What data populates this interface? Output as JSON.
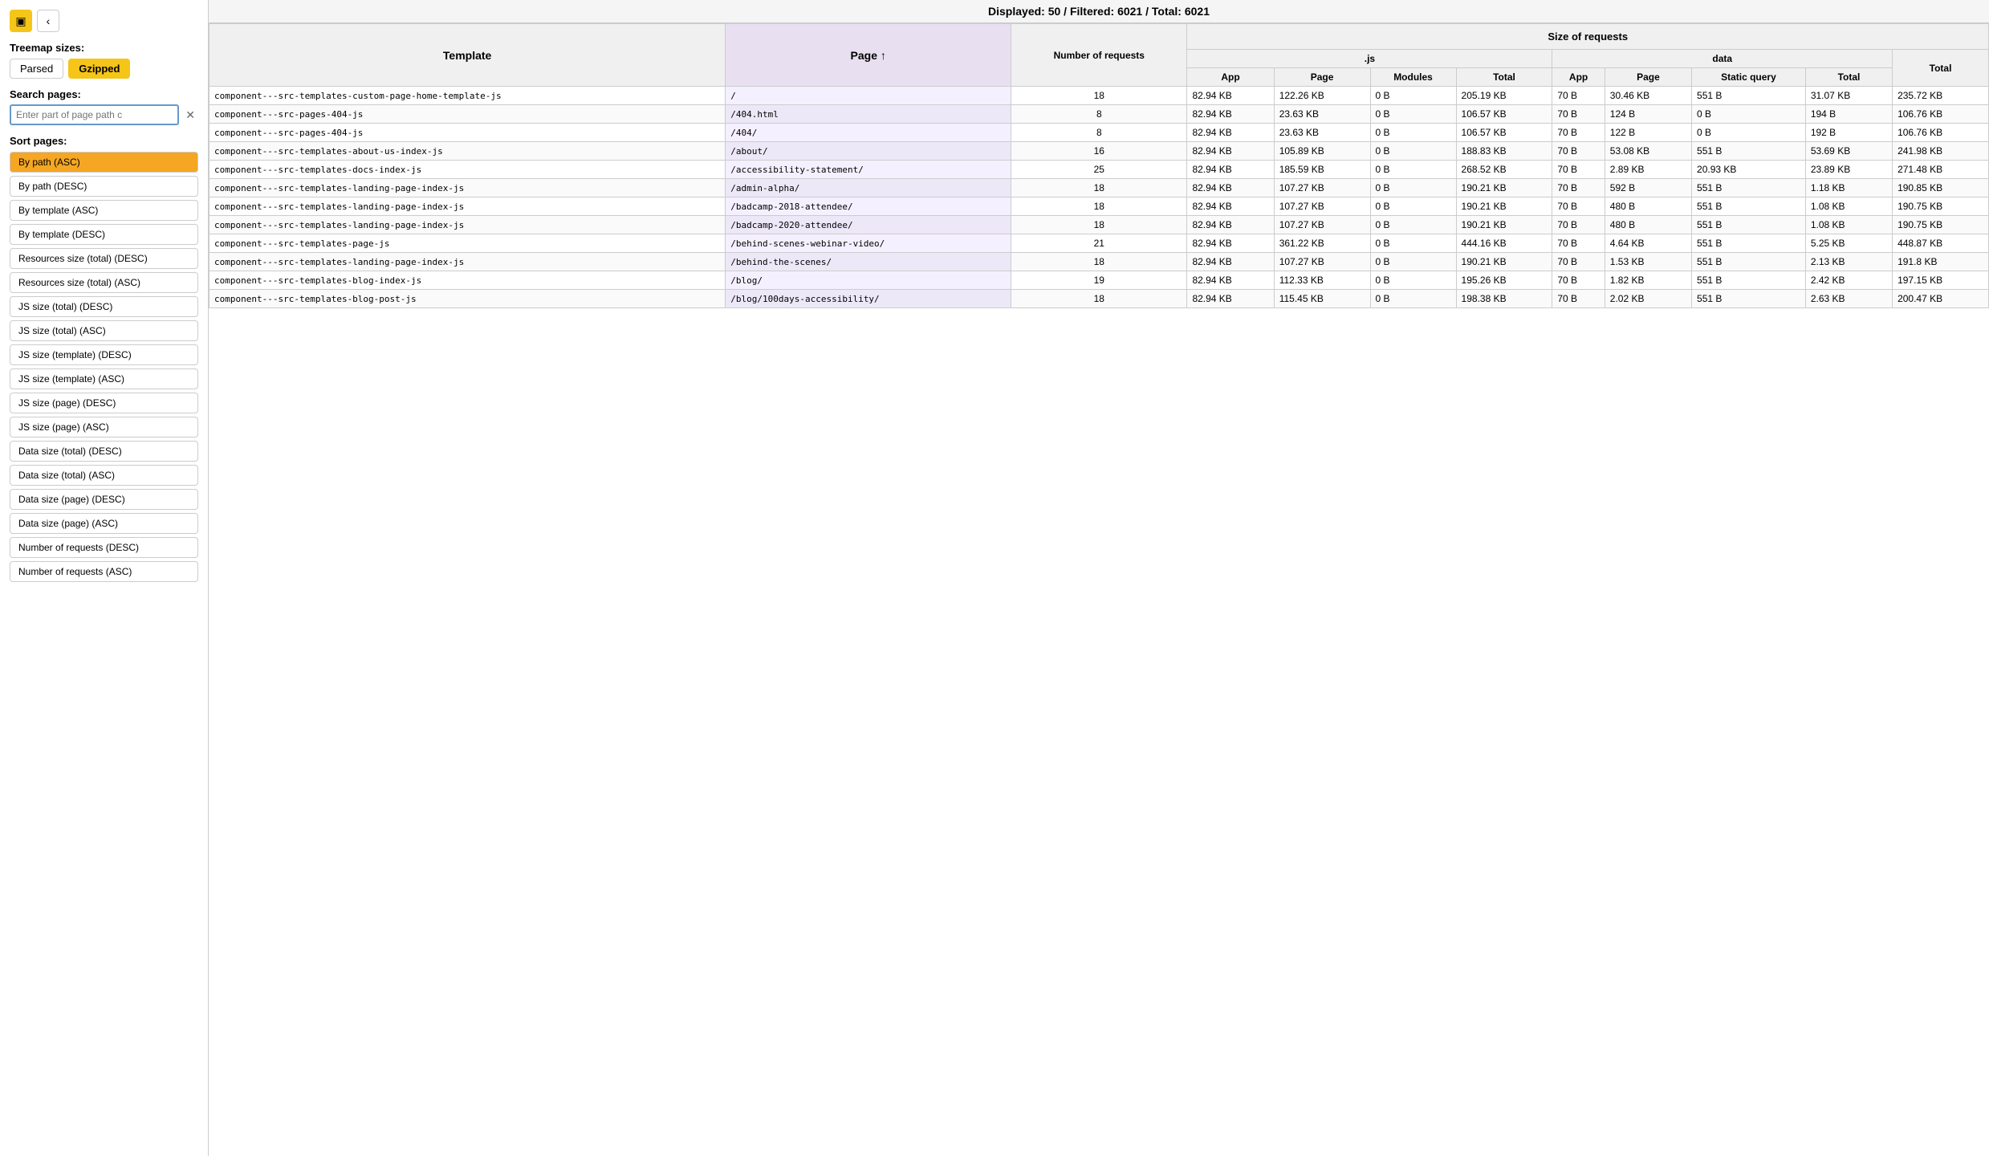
{
  "sidebar": {
    "treemap_sizes_label": "Treemap sizes:",
    "btn_treemap_icon": "▣",
    "btn_chevron": "‹",
    "btn_parsed": "Parsed",
    "btn_gzipped": "Gzipped",
    "search_label": "Search pages:",
    "search_placeholder": "Enter part of page path c",
    "search_value": "",
    "sort_label": "Sort pages:",
    "sort_options": [
      {
        "label": "By path (ASC)",
        "active": true
      },
      {
        "label": "By path (DESC)",
        "active": false
      },
      {
        "label": "By template (ASC)",
        "active": false
      },
      {
        "label": "By template (DESC)",
        "active": false
      },
      {
        "label": "Resources size (total) (DESC)",
        "active": false
      },
      {
        "label": "Resources size (total) (ASC)",
        "active": false
      },
      {
        "label": "JS size (total) (DESC)",
        "active": false
      },
      {
        "label": "JS size (total) (ASC)",
        "active": false
      },
      {
        "label": "JS size (template) (DESC)",
        "active": false
      },
      {
        "label": "JS size (template) (ASC)",
        "active": false
      },
      {
        "label": "JS size (page) (DESC)",
        "active": false
      },
      {
        "label": "JS size (page) (ASC)",
        "active": false
      },
      {
        "label": "Data size (total) (DESC)",
        "active": false
      },
      {
        "label": "Data size (total) (ASC)",
        "active": false
      },
      {
        "label": "Data size (page) (DESC)",
        "active": false
      },
      {
        "label": "Data size (page) (ASC)",
        "active": false
      },
      {
        "label": "Number of requests (DESC)",
        "active": false
      },
      {
        "label": "Number of requests (ASC)",
        "active": false
      }
    ]
  },
  "header": {
    "display_text": "Displayed: 50 / Filtered: 6021 / Total: 6021"
  },
  "table": {
    "col_template": "Template",
    "col_page": "Page ↑",
    "col_requests": "Number of requests",
    "col_size_requests": "Size of requests",
    "col_js": ".js",
    "col_data": "data",
    "col_total": "Total",
    "sub_app": "App",
    "sub_page": "Page",
    "sub_modules": "Modules",
    "sub_total": "Total",
    "sub_static_query": "Static query",
    "rows": [
      {
        "template": "component---src-templates-custom-page-home-template-js",
        "page": "/",
        "requests": "18",
        "js_app": "82.94 KB",
        "js_page": "122.26 KB",
        "js_modules": "0 B",
        "js_total": "205.19 KB",
        "data_app": "70 B",
        "data_page": "30.46 KB",
        "data_static_query": "551 B",
        "data_total": "31.07 KB",
        "total": "235.72 KB"
      },
      {
        "template": "component---src-pages-404-js",
        "page": "/404.html",
        "requests": "8",
        "js_app": "82.94 KB",
        "js_page": "23.63 KB",
        "js_modules": "0 B",
        "js_total": "106.57 KB",
        "data_app": "70 B",
        "data_page": "124 B",
        "data_static_query": "0 B",
        "data_total": "194 B",
        "total": "106.76 KB"
      },
      {
        "template": "component---src-pages-404-js",
        "page": "/404/",
        "requests": "8",
        "js_app": "82.94 KB",
        "js_page": "23.63 KB",
        "js_modules": "0 B",
        "js_total": "106.57 KB",
        "data_app": "70 B",
        "data_page": "122 B",
        "data_static_query": "0 B",
        "data_total": "192 B",
        "total": "106.76 KB"
      },
      {
        "template": "component---src-templates-about-us-index-js",
        "page": "/about/",
        "requests": "16",
        "js_app": "82.94 KB",
        "js_page": "105.89 KB",
        "js_modules": "0 B",
        "js_total": "188.83 KB",
        "data_app": "70 B",
        "data_page": "53.08 KB",
        "data_static_query": "551 B",
        "data_total": "53.69 KB",
        "total": "241.98 KB"
      },
      {
        "template": "component---src-templates-docs-index-js",
        "page": "/accessibility-statement/",
        "requests": "25",
        "js_app": "82.94 KB",
        "js_page": "185.59 KB",
        "js_modules": "0 B",
        "js_total": "268.52 KB",
        "data_app": "70 B",
        "data_page": "2.89 KB",
        "data_static_query": "20.93 KB",
        "data_total": "23.89 KB",
        "total": "271.48 KB"
      },
      {
        "template": "component---src-templates-landing-page-index-js",
        "page": "/admin-alpha/",
        "requests": "18",
        "js_app": "82.94 KB",
        "js_page": "107.27 KB",
        "js_modules": "0 B",
        "js_total": "190.21 KB",
        "data_app": "70 B",
        "data_page": "592 B",
        "data_static_query": "551 B",
        "data_total": "1.18 KB",
        "total": "190.85 KB"
      },
      {
        "template": "component---src-templates-landing-page-index-js",
        "page": "/badcamp-2018-attendee/",
        "requests": "18",
        "js_app": "82.94 KB",
        "js_page": "107.27 KB",
        "js_modules": "0 B",
        "js_total": "190.21 KB",
        "data_app": "70 B",
        "data_page": "480 B",
        "data_static_query": "551 B",
        "data_total": "1.08 KB",
        "total": "190.75 KB"
      },
      {
        "template": "component---src-templates-landing-page-index-js",
        "page": "/badcamp-2020-attendee/",
        "requests": "18",
        "js_app": "82.94 KB",
        "js_page": "107.27 KB",
        "js_modules": "0 B",
        "js_total": "190.21 KB",
        "data_app": "70 B",
        "data_page": "480 B",
        "data_static_query": "551 B",
        "data_total": "1.08 KB",
        "total": "190.75 KB"
      },
      {
        "template": "component---src-templates-page-js",
        "page": "/behind-scenes-webinar-video/",
        "requests": "21",
        "js_app": "82.94 KB",
        "js_page": "361.22 KB",
        "js_modules": "0 B",
        "js_total": "444.16 KB",
        "data_app": "70 B",
        "data_page": "4.64 KB",
        "data_static_query": "551 B",
        "data_total": "5.25 KB",
        "total": "448.87 KB"
      },
      {
        "template": "component---src-templates-landing-page-index-js",
        "page": "/behind-the-scenes/",
        "requests": "18",
        "js_app": "82.94 KB",
        "js_page": "107.27 KB",
        "js_modules": "0 B",
        "js_total": "190.21 KB",
        "data_app": "70 B",
        "data_page": "1.53 KB",
        "data_static_query": "551 B",
        "data_total": "2.13 KB",
        "total": "191.8 KB"
      },
      {
        "template": "component---src-templates-blog-index-js",
        "page": "/blog/",
        "requests": "19",
        "js_app": "82.94 KB",
        "js_page": "112.33 KB",
        "js_modules": "0 B",
        "js_total": "195.26 KB",
        "data_app": "70 B",
        "data_page": "1.82 KB",
        "data_static_query": "551 B",
        "data_total": "2.42 KB",
        "total": "197.15 KB"
      },
      {
        "template": "component---src-templates-blog-post-js",
        "page": "/blog/100days-accessibility/",
        "requests": "18",
        "js_app": "82.94 KB",
        "js_page": "115.45 KB",
        "js_modules": "0 B",
        "js_total": "198.38 KB",
        "data_app": "70 B",
        "data_page": "2.02 KB",
        "data_static_query": "551 B",
        "data_total": "2.63 KB",
        "total": "200.47 KB"
      }
    ]
  }
}
